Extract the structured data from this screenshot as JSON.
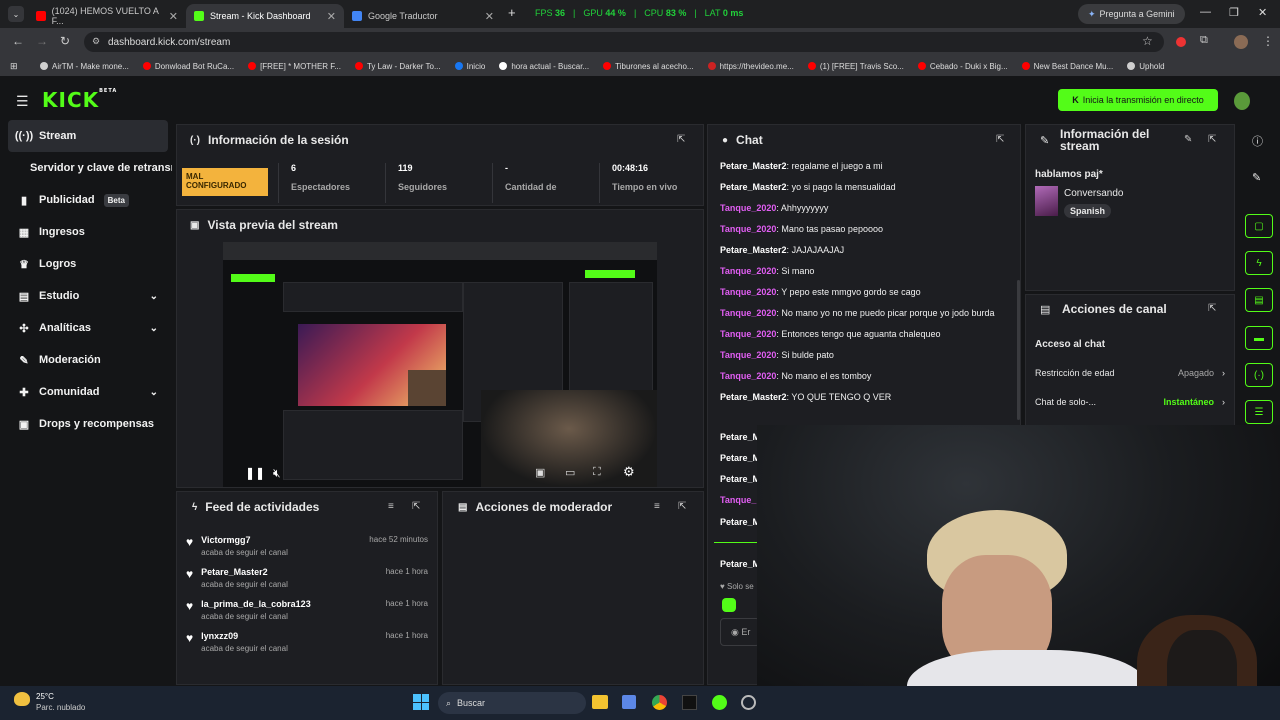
{
  "browser": {
    "tabs": [
      {
        "label": "(1024) HEMOS VUELTO A F...",
        "color": "#ff0000"
      },
      {
        "label": "Stream - Kick Dashboard",
        "color": "#53fc18"
      },
      {
        "label": "Google Traductor",
        "color": "#4285f4"
      }
    ],
    "perf": {
      "fps_label": "FPS",
      "fps": "36",
      "gpu_label": "GPU",
      "gpu": "44 %",
      "cpu_label": "CPU",
      "cpu": "83 %",
      "lat_label": "LAT",
      "lat": "0 ms"
    },
    "gemini": "Pregunta a Gemini",
    "url": "dashboard.kick.com/stream",
    "bookmarks": [
      {
        "label": "AirTM - Make mone...",
        "color": "#cfcfcf"
      },
      {
        "label": "Donwload Bot RuCa...",
        "color": "#ff0000"
      },
      {
        "label": "[FREE] * MOTHER F...",
        "color": "#ff0000"
      },
      {
        "label": "Ty Law - Darker To...",
        "color": "#ff0000"
      },
      {
        "label": "Inicio",
        "color": "#1877f2"
      },
      {
        "label": "hora actual - Buscar...",
        "color": "#ffffff"
      },
      {
        "label": "Tiburones al acecho...",
        "color": "#ff0000"
      },
      {
        "label": "https://thevideo.me...",
        "color": "#cc2222"
      },
      {
        "label": "(1) [FREE] Travis Sco...",
        "color": "#ff0000"
      },
      {
        "label": "Cebado - Duki x Big...",
        "color": "#ff0000"
      },
      {
        "label": "New Best Dance Mu...",
        "color": "#ff0000"
      },
      {
        "label": "Uphold",
        "color": "#cfcfcf"
      }
    ]
  },
  "header": {
    "logo": "KICK",
    "logo_tag": "BETA",
    "go_live": "Inicia la transmisión en directo"
  },
  "sidebar": {
    "items": [
      {
        "label": "Stream",
        "icon": "broadcast-icon"
      },
      {
        "label": "Servidor y clave de retransm",
        "icon": ""
      },
      {
        "label": "Publicidad",
        "icon": "megaphone-icon",
        "badge": "Beta"
      },
      {
        "label": "Ingresos",
        "icon": "chart-icon"
      },
      {
        "label": "Logros",
        "icon": "trophy-icon"
      },
      {
        "label": "Estudio",
        "icon": "studio-icon"
      },
      {
        "label": "Analíticas",
        "icon": "analytics-icon"
      },
      {
        "label": "Moderación",
        "icon": "wrench-icon"
      },
      {
        "label": "Comunidad",
        "icon": "community-icon"
      },
      {
        "label": "Drops y recompensas",
        "icon": "gift-icon"
      }
    ]
  },
  "session": {
    "title": "Información de la sesión",
    "status": "MAL CONFIGURADO",
    "stats": [
      {
        "value": "6",
        "label": "Espectadores"
      },
      {
        "value": "119",
        "label": "Seguidores"
      },
      {
        "value": "-",
        "label": "Cantidad de"
      },
      {
        "value": "00:48:16",
        "label": "Tiempo en vivo"
      }
    ]
  },
  "preview": {
    "title": "Vista previa del stream"
  },
  "feed": {
    "title": "Feed de actividades",
    "items": [
      {
        "name": "Victormgg7",
        "action": "acaba de seguir el canal",
        "time": "hace 52 minutos"
      },
      {
        "name": "Petare_Master2",
        "action": "acaba de seguir el canal",
        "time": "hace 1 hora"
      },
      {
        "name": "la_prima_de_la_cobra123",
        "action": "acaba de seguir el canal",
        "time": "hace 1 hora"
      },
      {
        "name": "lynxzz09",
        "action": "acaba de seguir el canal",
        "time": "hace 1 hora"
      }
    ]
  },
  "mod": {
    "title": "Acciones de moderador"
  },
  "chat": {
    "title": "Chat",
    "messages": [
      {
        "user": "Petare_Master2",
        "text": "regalame el juego a mi",
        "color": "#ffffff"
      },
      {
        "user": "Petare_Master2",
        "text": "yo si pago la mensualidad",
        "color": "#ffffff"
      },
      {
        "user": "Tanque_2020",
        "text": "Ahhyyyyyyy",
        "color": "#e05ef2"
      },
      {
        "user": "Tanque_2020",
        "text": "Mano tas pasao pepoooo",
        "color": "#e05ef2"
      },
      {
        "user": "Petare_Master2",
        "text": "JAJAJAAJAJ",
        "color": "#ffffff"
      },
      {
        "user": "Tanque_2020",
        "text": "Si mano",
        "color": "#e05ef2"
      },
      {
        "user": "Tanque_2020",
        "text": "Y pepo este mmgvo gordo se cago",
        "color": "#e05ef2"
      },
      {
        "user": "Tanque_2020",
        "text": "No mano yo no me puedo picar porque yo jodo burda",
        "color": "#e05ef2"
      },
      {
        "user": "Tanque_2020",
        "text": "Entonces tengo que aguanta chalequeo",
        "color": "#e05ef2"
      },
      {
        "user": "Tanque_2020",
        "text": "Si bulde pato",
        "color": "#e05ef2"
      },
      {
        "user": "Tanque_2020",
        "text": "No mano el es tomboy",
        "color": "#e05ef2"
      },
      {
        "user": "Petare_Master2",
        "text": "YO QUE TENGO Q VER",
        "color": "#ffffff"
      }
    ],
    "partial_users": [
      {
        "user": "Petare_M",
        "color": "#ffffff"
      },
      {
        "user": "Petare_M",
        "color": "#ffffff"
      },
      {
        "user": "Petare_M",
        "color": "#ffffff"
      },
      {
        "user": "Tanque_",
        "color": "#e05ef2"
      },
      {
        "user": "Petare_M",
        "color": "#ffffff"
      },
      {
        "user": "Petare_M",
        "color": "#ffffff"
      }
    ],
    "solo_label": "Solo se",
    "input_stub": "Er"
  },
  "stream_info": {
    "title": "Información del stream",
    "stream_title": "hablamos paj*",
    "category": "Conversando",
    "language": "Spanish"
  },
  "channel_actions": {
    "title": "Acciones de canal",
    "section": "Acceso al chat",
    "rows": [
      {
        "label": "Restricción de edad",
        "value": "Apagado",
        "value_color": "#a8a8a8"
      },
      {
        "label": "Chat de solo-...",
        "value": "Instantáneo",
        "value_color": "#53fc18"
      }
    ]
  },
  "taskbar": {
    "temp": "25°C",
    "weather": "Parc. nublado",
    "search": "Buscar"
  },
  "colors": {
    "accent": "#53fc18",
    "warning": "#f3b33d",
    "bg": "#141517",
    "panel": "#1d1e22"
  }
}
